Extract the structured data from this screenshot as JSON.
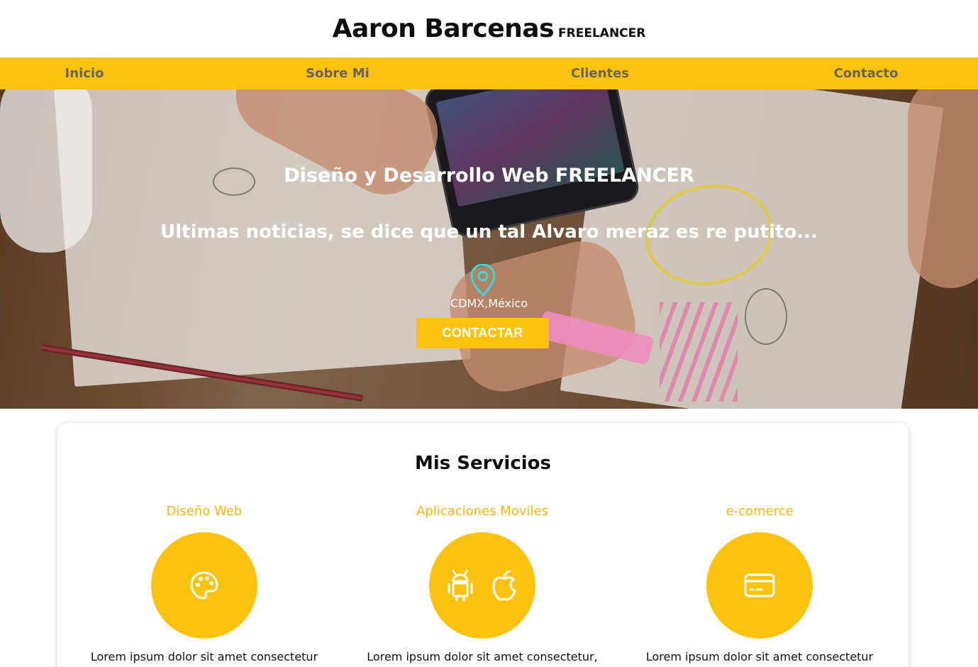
{
  "header": {
    "brand_name": "Aaron Barcenas",
    "brand_tag": "FREELANCER"
  },
  "nav": {
    "items": [
      {
        "label": "Inicio"
      },
      {
        "label": "Sobre Mi"
      },
      {
        "label": "Clientes"
      },
      {
        "label": "Contacto"
      }
    ],
    "background": "#fdc20f",
    "text_color": "#6b6356"
  },
  "hero": {
    "title": "Diseño y Desarrollo Web FREELANCER",
    "subtitle": "Ultimas noticias, se dice que un tal Alvaro meraz es re putito...",
    "location": "CDMX,México",
    "location_icon": "map-pin-icon",
    "location_icon_color": "#3fd3d6",
    "cta_label": "CONTACTAR"
  },
  "services": {
    "title": "Mis Servicios",
    "accent": "#fdc20f",
    "items": [
      {
        "name": "Diseño Web",
        "icons": [
          "palette-icon"
        ],
        "description": "Lorem ipsum dolor sit amet consectetur"
      },
      {
        "name": "Aplicaciones Moviles",
        "icons": [
          "android-icon",
          "apple-icon"
        ],
        "description": "Lorem ipsum dolor sit amet consectetur,"
      },
      {
        "name": "e-comerce",
        "icons": [
          "credit-card-icon"
        ],
        "description": "Lorem ipsum dolor sit amet consectetur"
      }
    ]
  }
}
